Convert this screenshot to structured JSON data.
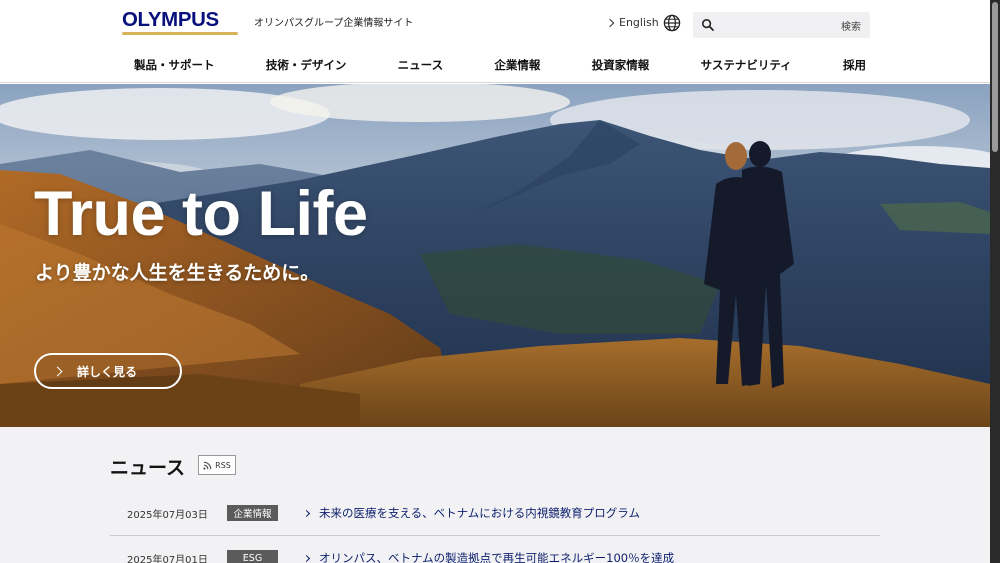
{
  "header": {
    "logo_text": "OLYMPUS",
    "site_name": "オリンパスグループ企業情報サイト",
    "language_link": "English",
    "search": {
      "placeholder": "",
      "button_label": "検索"
    }
  },
  "nav": {
    "items": [
      {
        "label": "製品・サポート"
      },
      {
        "label": "技術・デザイン"
      },
      {
        "label": "ニュース"
      },
      {
        "label": "企業情報"
      },
      {
        "label": "投資家情報"
      },
      {
        "label": "サステナビリティ"
      },
      {
        "label": "採用"
      }
    ]
  },
  "hero": {
    "title": "True to Life",
    "subtitle": "より豊かな人生を生きるために。",
    "button_label": "詳しく見る"
  },
  "news": {
    "title": "ニュース",
    "rss_label": "RSS",
    "items": [
      {
        "date": "2025年07月03日",
        "category": "企業情報",
        "headline": "未来の医療を支える、ベトナムにおける内視鏡教育プログラム"
      },
      {
        "date": "2025年07月01日",
        "category": "ESG",
        "headline": "オリンパス、ベトナムの製造拠点で再生可能エネルギー100％を達成"
      }
    ]
  },
  "colors": {
    "brand_navy": "#08107b",
    "brand_gold": "#d6b25a",
    "badge_gray": "#5b5b5b",
    "link_navy": "#0d1f6e"
  },
  "icons": [
    "chevron-right-icon",
    "globe-icon",
    "search-icon",
    "rss-icon"
  ]
}
